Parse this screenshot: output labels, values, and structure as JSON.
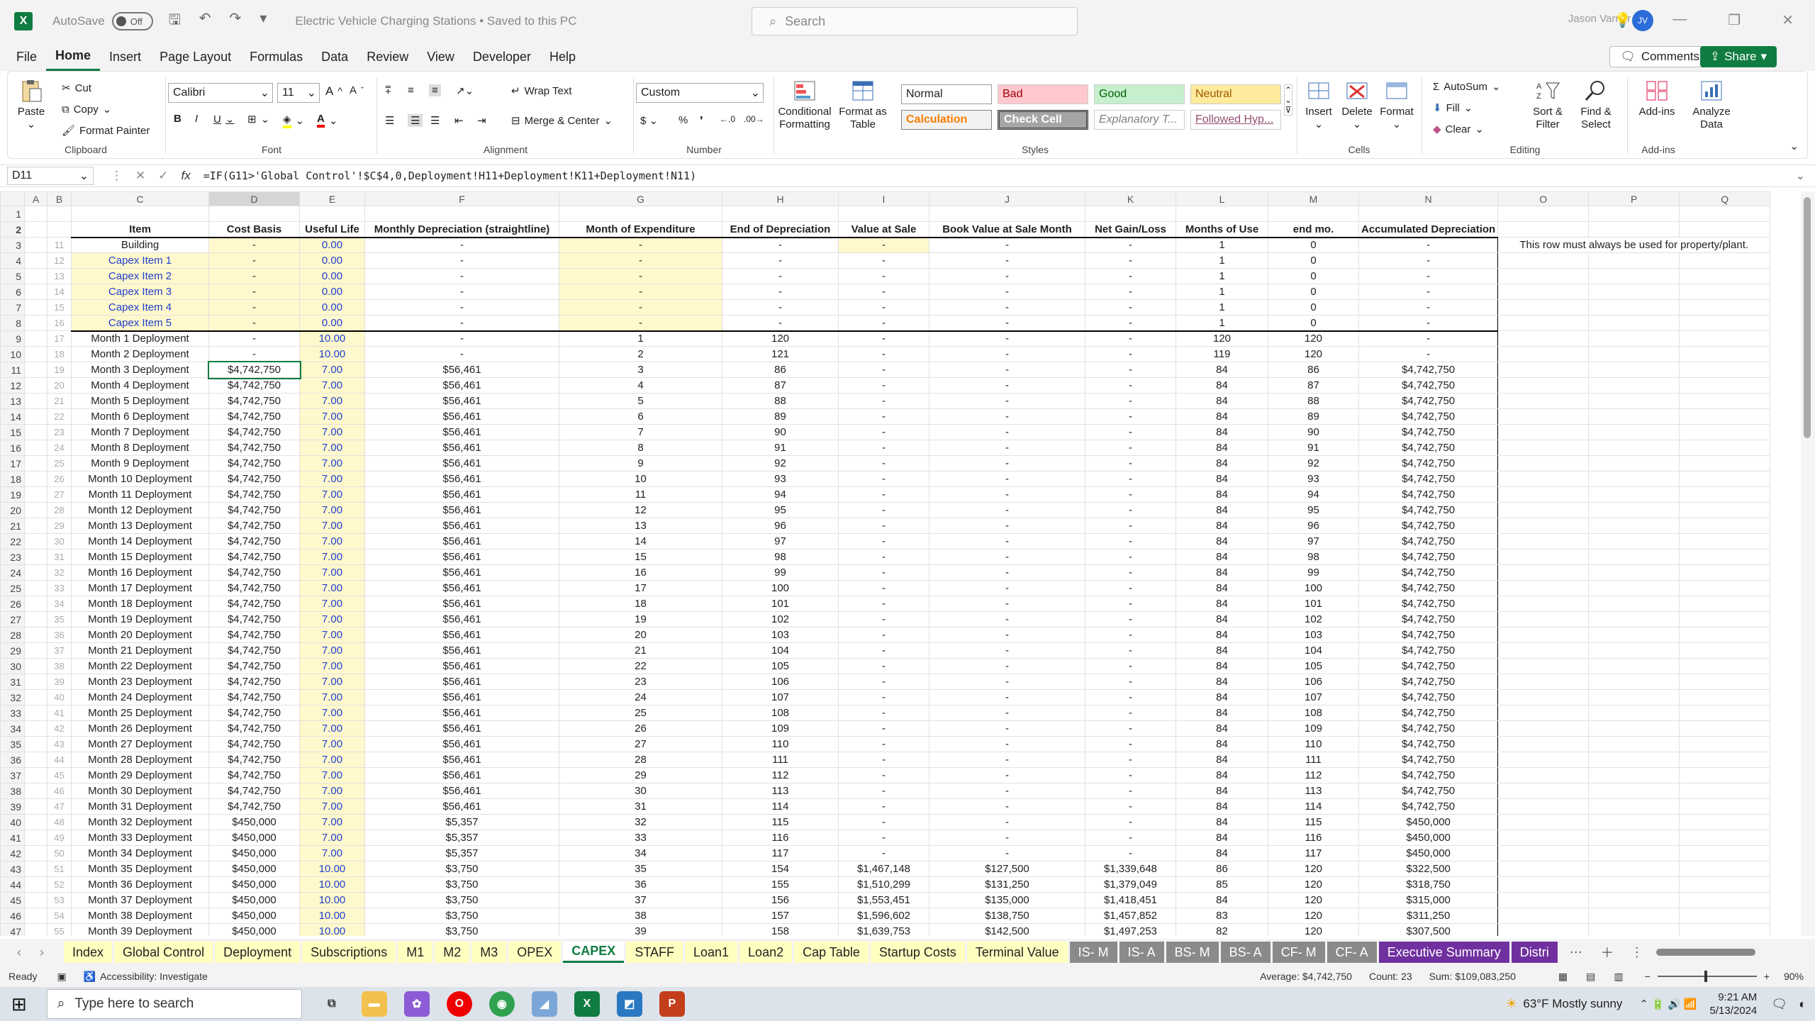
{
  "title_bar": {
    "autosave_label": "AutoSave",
    "autosave_state": "Off",
    "document_title": "Electric Vehicle Charging Stations • Saved to this PC",
    "search_placeholder": "Search",
    "user_name": "Jason Varner",
    "user_initials": "JV"
  },
  "menu": {
    "tabs": [
      "File",
      "Home",
      "Insert",
      "Page Layout",
      "Formulas",
      "Data",
      "Review",
      "View",
      "Developer",
      "Help"
    ],
    "active": "Home",
    "comments": "Comments",
    "share": "Share"
  },
  "ribbon": {
    "clipboard": {
      "paste": "Paste",
      "cut": "Cut",
      "copy": "Copy",
      "format_painter": "Format Painter",
      "label": "Clipboard"
    },
    "font": {
      "name": "Calibri",
      "size": "11",
      "label": "Font"
    },
    "alignment": {
      "wrap_text": "Wrap Text",
      "merge_center": "Merge & Center",
      "label": "Alignment"
    },
    "number": {
      "format": "Custom",
      "label": "Number"
    },
    "styles": {
      "conditional": "Conditional Formatting",
      "format_table": "Format as Table",
      "cells": [
        "Normal",
        "Bad",
        "Good",
        "Neutral",
        "Calculation",
        "Check Cell",
        "Explanatory T...",
        "Followed Hyp..."
      ],
      "label": "Styles"
    },
    "cells": {
      "insert": "Insert",
      "delete": "Delete",
      "format": "Format",
      "label": "Cells"
    },
    "editing": {
      "autosum": "AutoSum",
      "fill": "Fill",
      "clear": "Clear",
      "sort_filter": "Sort & Filter",
      "find_select": "Find & Select",
      "label": "Editing"
    },
    "addins": {
      "addins": "Add-ins",
      "analyze": "Analyze Data",
      "label": "Add-ins"
    }
  },
  "formula_bar": {
    "name_box": "D11",
    "formula": "=IF(G11>'Global Control'!$C$4,0,Deployment!H11+Deployment!K11+Deployment!N11)"
  },
  "sheet": {
    "columns": [
      "A",
      "B",
      "C",
      "D",
      "E",
      "F",
      "G",
      "H",
      "I",
      "J",
      "K",
      "L",
      "M",
      "N",
      "O",
      "P",
      "Q"
    ],
    "headers": [
      "Item",
      "Cost Basis",
      "Useful Life",
      "Monthly Depreciation (straightline)",
      "Month of Expenditure",
      "End of Depreciation",
      "Value at Sale",
      "Book Value at Sale Month",
      "Net Gain/Loss",
      "Months of Use",
      "end mo.",
      "Accumulated Depreciation"
    ],
    "note": "This row must always be used for property/plant.",
    "rows": [
      [
        "3",
        "11",
        "Building",
        "-",
        "0.00",
        "-",
        "-",
        "-",
        "-",
        "-",
        "-",
        "1",
        "0",
        "-"
      ],
      [
        "4",
        "12",
        "Capex Item 1",
        "-",
        "0.00",
        "-",
        "-",
        "-",
        "-",
        "-",
        "-",
        "1",
        "0",
        "-"
      ],
      [
        "5",
        "13",
        "Capex Item 2",
        "-",
        "0.00",
        "-",
        "-",
        "-",
        "-",
        "-",
        "-",
        "1",
        "0",
        "-"
      ],
      [
        "6",
        "14",
        "Capex Item 3",
        "-",
        "0.00",
        "-",
        "-",
        "-",
        "-",
        "-",
        "-",
        "1",
        "0",
        "-"
      ],
      [
        "7",
        "15",
        "Capex Item 4",
        "-",
        "0.00",
        "-",
        "-",
        "-",
        "-",
        "-",
        "-",
        "1",
        "0",
        "-"
      ],
      [
        "8",
        "16",
        "Capex Item 5",
        "-",
        "0.00",
        "-",
        "-",
        "-",
        "-",
        "-",
        "-",
        "1",
        "0",
        "-"
      ],
      [
        "9",
        "17",
        "Month 1 Deployment",
        "-",
        "10.00",
        "-",
        "1",
        "120",
        "-",
        "-",
        "-",
        "120",
        "120",
        "-"
      ],
      [
        "10",
        "18",
        "Month 2 Deployment",
        "-",
        "10.00",
        "-",
        "2",
        "121",
        "-",
        "-",
        "-",
        "119",
        "120",
        "-"
      ],
      [
        "11",
        "19",
        "Month 3 Deployment",
        "$4,742,750",
        "7.00",
        "$56,461",
        "3",
        "86",
        "-",
        "-",
        "-",
        "84",
        "86",
        "$4,742,750"
      ],
      [
        "12",
        "20",
        "Month 4 Deployment",
        "$4,742,750",
        "7.00",
        "$56,461",
        "4",
        "87",
        "-",
        "-",
        "-",
        "84",
        "87",
        "$4,742,750"
      ],
      [
        "13",
        "21",
        "Month 5 Deployment",
        "$4,742,750",
        "7.00",
        "$56,461",
        "5",
        "88",
        "-",
        "-",
        "-",
        "84",
        "88",
        "$4,742,750"
      ],
      [
        "14",
        "22",
        "Month 6 Deployment",
        "$4,742,750",
        "7.00",
        "$56,461",
        "6",
        "89",
        "-",
        "-",
        "-",
        "84",
        "89",
        "$4,742,750"
      ],
      [
        "15",
        "23",
        "Month 7 Deployment",
        "$4,742,750",
        "7.00",
        "$56,461",
        "7",
        "90",
        "-",
        "-",
        "-",
        "84",
        "90",
        "$4,742,750"
      ],
      [
        "16",
        "24",
        "Month 8 Deployment",
        "$4,742,750",
        "7.00",
        "$56,461",
        "8",
        "91",
        "-",
        "-",
        "-",
        "84",
        "91",
        "$4,742,750"
      ],
      [
        "17",
        "25",
        "Month 9 Deployment",
        "$4,742,750",
        "7.00",
        "$56,461",
        "9",
        "92",
        "-",
        "-",
        "-",
        "84",
        "92",
        "$4,742,750"
      ],
      [
        "18",
        "26",
        "Month 10 Deployment",
        "$4,742,750",
        "7.00",
        "$56,461",
        "10",
        "93",
        "-",
        "-",
        "-",
        "84",
        "93",
        "$4,742,750"
      ],
      [
        "19",
        "27",
        "Month 11 Deployment",
        "$4,742,750",
        "7.00",
        "$56,461",
        "11",
        "94",
        "-",
        "-",
        "-",
        "84",
        "94",
        "$4,742,750"
      ],
      [
        "20",
        "28",
        "Month 12 Deployment",
        "$4,742,750",
        "7.00",
        "$56,461",
        "12",
        "95",
        "-",
        "-",
        "-",
        "84",
        "95",
        "$4,742,750"
      ],
      [
        "21",
        "29",
        "Month 13 Deployment",
        "$4,742,750",
        "7.00",
        "$56,461",
        "13",
        "96",
        "-",
        "-",
        "-",
        "84",
        "96",
        "$4,742,750"
      ],
      [
        "22",
        "30",
        "Month 14 Deployment",
        "$4,742,750",
        "7.00",
        "$56,461",
        "14",
        "97",
        "-",
        "-",
        "-",
        "84",
        "97",
        "$4,742,750"
      ],
      [
        "23",
        "31",
        "Month 15 Deployment",
        "$4,742,750",
        "7.00",
        "$56,461",
        "15",
        "98",
        "-",
        "-",
        "-",
        "84",
        "98",
        "$4,742,750"
      ],
      [
        "24",
        "32",
        "Month 16 Deployment",
        "$4,742,750",
        "7.00",
        "$56,461",
        "16",
        "99",
        "-",
        "-",
        "-",
        "84",
        "99",
        "$4,742,750"
      ],
      [
        "25",
        "33",
        "Month 17 Deployment",
        "$4,742,750",
        "7.00",
        "$56,461",
        "17",
        "100",
        "-",
        "-",
        "-",
        "84",
        "100",
        "$4,742,750"
      ],
      [
        "26",
        "34",
        "Month 18 Deployment",
        "$4,742,750",
        "7.00",
        "$56,461",
        "18",
        "101",
        "-",
        "-",
        "-",
        "84",
        "101",
        "$4,742,750"
      ],
      [
        "27",
        "35",
        "Month 19 Deployment",
        "$4,742,750",
        "7.00",
        "$56,461",
        "19",
        "102",
        "-",
        "-",
        "-",
        "84",
        "102",
        "$4,742,750"
      ],
      [
        "28",
        "36",
        "Month 20 Deployment",
        "$4,742,750",
        "7.00",
        "$56,461",
        "20",
        "103",
        "-",
        "-",
        "-",
        "84",
        "103",
        "$4,742,750"
      ],
      [
        "29",
        "37",
        "Month 21 Deployment",
        "$4,742,750",
        "7.00",
        "$56,461",
        "21",
        "104",
        "-",
        "-",
        "-",
        "84",
        "104",
        "$4,742,750"
      ],
      [
        "30",
        "38",
        "Month 22 Deployment",
        "$4,742,750",
        "7.00",
        "$56,461",
        "22",
        "105",
        "-",
        "-",
        "-",
        "84",
        "105",
        "$4,742,750"
      ],
      [
        "31",
        "39",
        "Month 23 Deployment",
        "$4,742,750",
        "7.00",
        "$56,461",
        "23",
        "106",
        "-",
        "-",
        "-",
        "84",
        "106",
        "$4,742,750"
      ],
      [
        "32",
        "40",
        "Month 24 Deployment",
        "$4,742,750",
        "7.00",
        "$56,461",
        "24",
        "107",
        "-",
        "-",
        "-",
        "84",
        "107",
        "$4,742,750"
      ],
      [
        "33",
        "41",
        "Month 25 Deployment",
        "$4,742,750",
        "7.00",
        "$56,461",
        "25",
        "108",
        "-",
        "-",
        "-",
        "84",
        "108",
        "$4,742,750"
      ],
      [
        "34",
        "42",
        "Month 26 Deployment",
        "$4,742,750",
        "7.00",
        "$56,461",
        "26",
        "109",
        "-",
        "-",
        "-",
        "84",
        "109",
        "$4,742,750"
      ],
      [
        "35",
        "43",
        "Month 27 Deployment",
        "$4,742,750",
        "7.00",
        "$56,461",
        "27",
        "110",
        "-",
        "-",
        "-",
        "84",
        "110",
        "$4,742,750"
      ],
      [
        "36",
        "44",
        "Month 28 Deployment",
        "$4,742,750",
        "7.00",
        "$56,461",
        "28",
        "111",
        "-",
        "-",
        "-",
        "84",
        "111",
        "$4,742,750"
      ],
      [
        "37",
        "45",
        "Month 29 Deployment",
        "$4,742,750",
        "7.00",
        "$56,461",
        "29",
        "112",
        "-",
        "-",
        "-",
        "84",
        "112",
        "$4,742,750"
      ],
      [
        "38",
        "46",
        "Month 30 Deployment",
        "$4,742,750",
        "7.00",
        "$56,461",
        "30",
        "113",
        "-",
        "-",
        "-",
        "84",
        "113",
        "$4,742,750"
      ],
      [
        "39",
        "47",
        "Month 31 Deployment",
        "$4,742,750",
        "7.00",
        "$56,461",
        "31",
        "114",
        "-",
        "-",
        "-",
        "84",
        "114",
        "$4,742,750"
      ],
      [
        "40",
        "48",
        "Month 32 Deployment",
        "$450,000",
        "7.00",
        "$5,357",
        "32",
        "115",
        "-",
        "-",
        "-",
        "84",
        "115",
        "$450,000"
      ],
      [
        "41",
        "49",
        "Month 33 Deployment",
        "$450,000",
        "7.00",
        "$5,357",
        "33",
        "116",
        "-",
        "-",
        "-",
        "84",
        "116",
        "$450,000"
      ],
      [
        "42",
        "50",
        "Month 34 Deployment",
        "$450,000",
        "7.00",
        "$5,357",
        "34",
        "117",
        "-",
        "-",
        "-",
        "84",
        "117",
        "$450,000"
      ],
      [
        "43",
        "51",
        "Month 35 Deployment",
        "$450,000",
        "10.00",
        "$3,750",
        "35",
        "154",
        "$1,467,148",
        "$127,500",
        "$1,339,648",
        "86",
        "120",
        "$322,500"
      ],
      [
        "44",
        "52",
        "Month 36 Deployment",
        "$450,000",
        "10.00",
        "$3,750",
        "36",
        "155",
        "$1,510,299",
        "$131,250",
        "$1,379,049",
        "85",
        "120",
        "$318,750"
      ],
      [
        "45",
        "53",
        "Month 37 Deployment",
        "$450,000",
        "10.00",
        "$3,750",
        "37",
        "156",
        "$1,553,451",
        "$135,000",
        "$1,418,451",
        "84",
        "120",
        "$315,000"
      ],
      [
        "46",
        "54",
        "Month 38 Deployment",
        "$450,000",
        "10.00",
        "$3,750",
        "38",
        "157",
        "$1,596,602",
        "$138,750",
        "$1,457,852",
        "83",
        "120",
        "$311,250"
      ],
      [
        "47",
        "55",
        "Month 39 Deployment",
        "$450,000",
        "10.00",
        "$3,750",
        "39",
        "158",
        "$1,639,753",
        "$142,500",
        "$1,497,253",
        "82",
        "120",
        "$307,500"
      ]
    ]
  },
  "sheet_tabs": [
    "Index",
    "Global Control",
    "Deployment",
    "Subscriptions",
    "M1",
    "M2",
    "M3",
    "OPEX",
    "CAPEX",
    "STAFF",
    "Loan1",
    "Loan2",
    "Cap Table",
    "Startup Costs",
    "Terminal Value",
    "IS- M",
    "IS- A",
    "BS- M",
    "BS- A",
    "CF- M",
    "CF- A",
    "Executive Summary",
    "Distri"
  ],
  "active_sheet": "CAPEX",
  "status": {
    "ready": "Ready",
    "accessibility": "Accessibility: Investigate",
    "average": "Average: $4,742,750",
    "count": "Count: 23",
    "sum": "Sum: $109,083,250",
    "zoom": "90%"
  },
  "taskbar": {
    "search_placeholder": "Type here to search",
    "weather": "63°F  Mostly sunny",
    "time": "9:21 AM",
    "date": "5/13/2024"
  }
}
